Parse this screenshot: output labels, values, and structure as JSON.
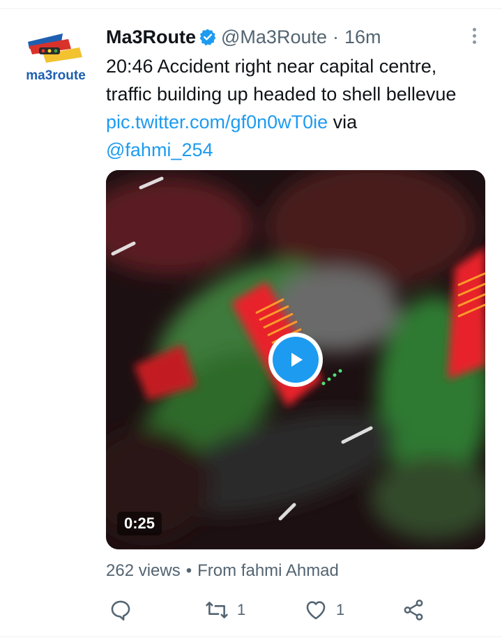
{
  "tweet": {
    "author_name": "Ma3Route",
    "handle": "@Ma3Route",
    "separator": "·",
    "time": "16m",
    "text_main": "20:46 Accident right near capital centre, traffic building up headed to shell bellevue ",
    "link_text": "pic.twitter.com/gf0n0wT0ie",
    "via_text": " via ",
    "mention": "@fahmi_254",
    "avatar_text": "ma3route"
  },
  "media": {
    "duration": "0:25"
  },
  "meta": {
    "views": "262 views",
    "dot": "•",
    "from": "From fahmi Ahmad"
  },
  "actions": {
    "reply_icon": "reply-icon",
    "retweet_count": "1",
    "like_count": "1",
    "share_icon": "share-icon"
  },
  "colors": {
    "link": "#1d9bf0",
    "secondary_text": "#536471",
    "primary_text": "#0f1419"
  }
}
